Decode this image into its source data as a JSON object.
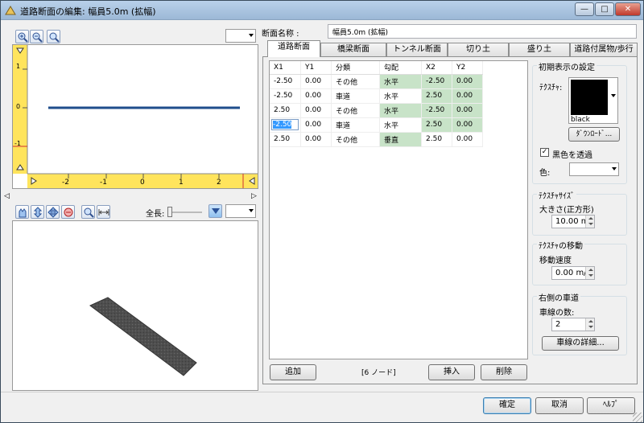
{
  "window": {
    "title": "道路断面の編集: 幅員5.0m (拡幅)",
    "controls": [
      "—",
      "□",
      "✕"
    ]
  },
  "left": {
    "ruler_v": [
      "1",
      "0",
      "-1"
    ],
    "ruler_h": [
      "-2",
      "-1",
      "0",
      "1",
      "2"
    ],
    "zenchou_label": "全長:"
  },
  "name_label": "断面名称 :",
  "name_value": "幅員5.0m (拡幅)",
  "tabs": [
    "道路断面",
    "橋梁断面",
    "トンネル断面",
    "切り土",
    "盛り土",
    "道路付属物/歩行"
  ],
  "table": {
    "headers": [
      "X1",
      "Y1",
      "分類",
      "勾配",
      "X2",
      "Y2"
    ],
    "rows": [
      [
        "-2.50",
        "0.00",
        "その他",
        "水平",
        "-2.50",
        "0.00"
      ],
      [
        "-2.50",
        "0.00",
        "車道",
        "水平",
        "2.50",
        "0.00"
      ],
      [
        "2.50",
        "0.00",
        "その他",
        "水平",
        "-2.50",
        "0.00"
      ],
      [
        "-2.50",
        "0.00",
        "車道",
        "水平",
        "2.50",
        "0.00"
      ],
      [
        "2.50",
        "0.00",
        "その他",
        "垂直",
        "2.50",
        "0.00"
      ]
    ]
  },
  "node_count": "[6 ノード]",
  "buttons": {
    "add": "追加",
    "insert": "挿入",
    "delete": "削除",
    "ok": "確定",
    "cancel": "取消",
    "help": "ﾍﾙﾌﾟ",
    "download": "ﾀﾞｳﾝﾛｰﾄﾞ...",
    "lanes_detail": "車線の詳細..."
  },
  "initial": {
    "group": "初期表示の設定",
    "texture_label": "ﾃｸｽﾁｬ:",
    "texture_name": "black",
    "transparent_label": "黒色を透過",
    "color_label": "色:"
  },
  "texsize": {
    "group": "ﾃｸｽﾁｬｻｲｽﾞ",
    "size_label": "大きさ(正方形)",
    "size_value": "10.00 m"
  },
  "texmove": {
    "group": "ﾃｸｽﾁｬの移動",
    "speed_label": "移動速度",
    "speed_value": "0.00 m/s"
  },
  "lanes": {
    "group": "右側の車道",
    "count_label": "車線の数:",
    "count_value": "2"
  },
  "colors": {
    "profile_line": "#1f4e8c",
    "ruler": "#ffe45c",
    "green_cell": "#c8e3c8",
    "selected": "#3399ff"
  }
}
